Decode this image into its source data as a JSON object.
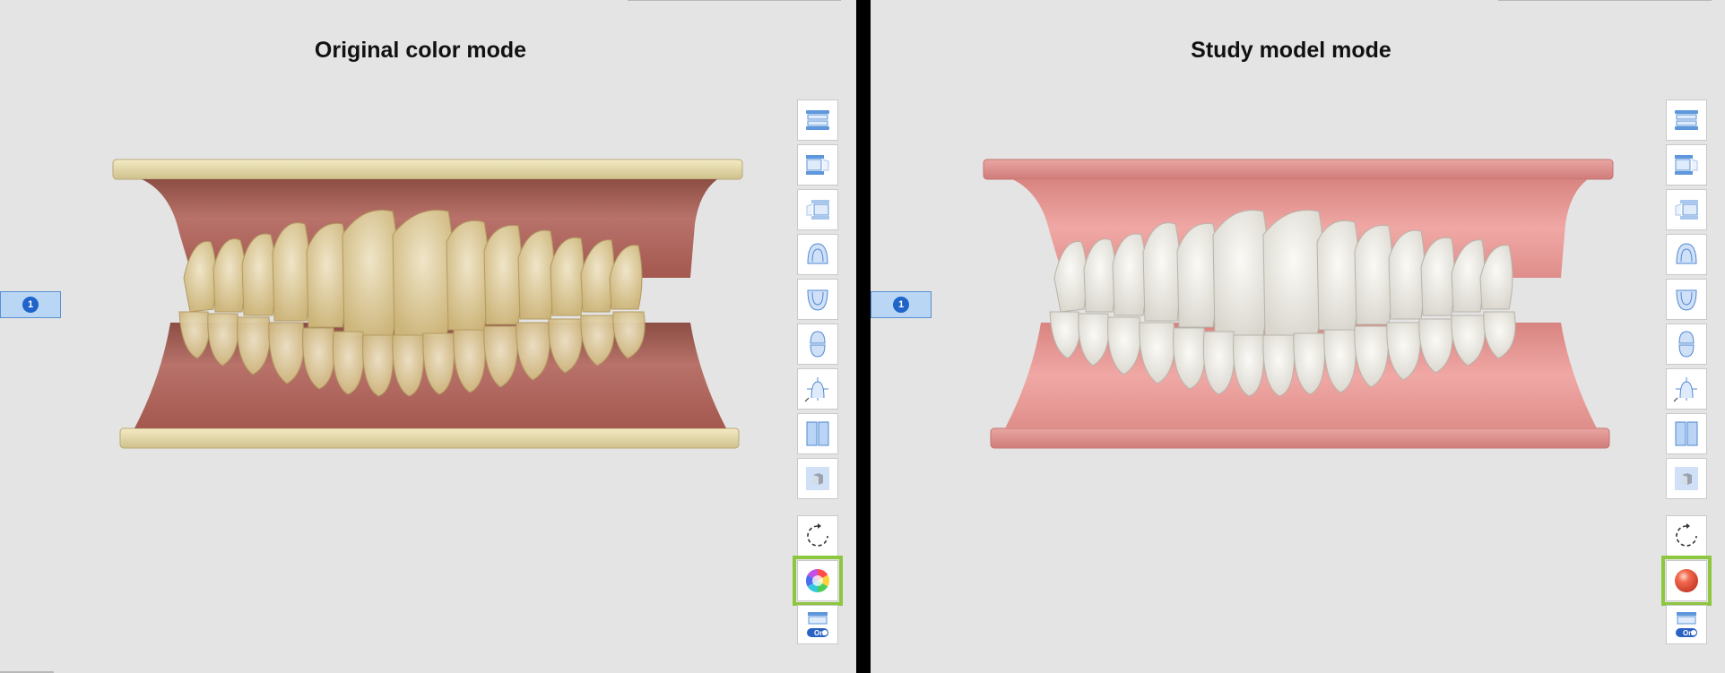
{
  "panels": [
    {
      "title": "Original color mode",
      "scan_tab": "1",
      "render_mode": "original-color",
      "colors": {
        "base": "#e9dcac",
        "gum": "#b46a5c",
        "teeth": "#e7d8b0"
      },
      "toolbar": {
        "view_buttons": [
          "full-arch-front-icon",
          "right-side-view-icon",
          "left-side-view-icon",
          "upper-occlusal-icon",
          "lower-occlusal-icon",
          "split-occlusal-icon",
          "measurement-view-icon",
          "dual-view-icon",
          "cube-view-icon"
        ],
        "action_buttons": [
          "reset-rotation-icon",
          "color-wheel-icon",
          "toggle-arch-icon"
        ],
        "toggle_label": "On",
        "highlighted": "color-wheel-icon"
      }
    },
    {
      "title": "Study model mode",
      "scan_tab": "1",
      "render_mode": "study-model",
      "colors": {
        "base": "#d98a87",
        "gum": "#e39896",
        "teeth": "#f1efe9"
      },
      "toolbar": {
        "view_buttons": [
          "full-arch-front-icon",
          "right-side-view-icon",
          "left-side-view-icon",
          "upper-occlusal-icon",
          "lower-occlusal-icon",
          "split-occlusal-icon",
          "measurement-view-icon",
          "dual-view-icon",
          "cube-view-icon"
        ],
        "action_buttons": [
          "reset-rotation-icon",
          "study-model-icon",
          "toggle-arch-icon"
        ],
        "toggle_label": "On",
        "highlighted": "study-model-icon"
      }
    }
  ],
  "accent": {
    "highlight": "#8dc63f",
    "tab_fill": "#b9d7f5",
    "tab_num": "#1f64c9"
  }
}
